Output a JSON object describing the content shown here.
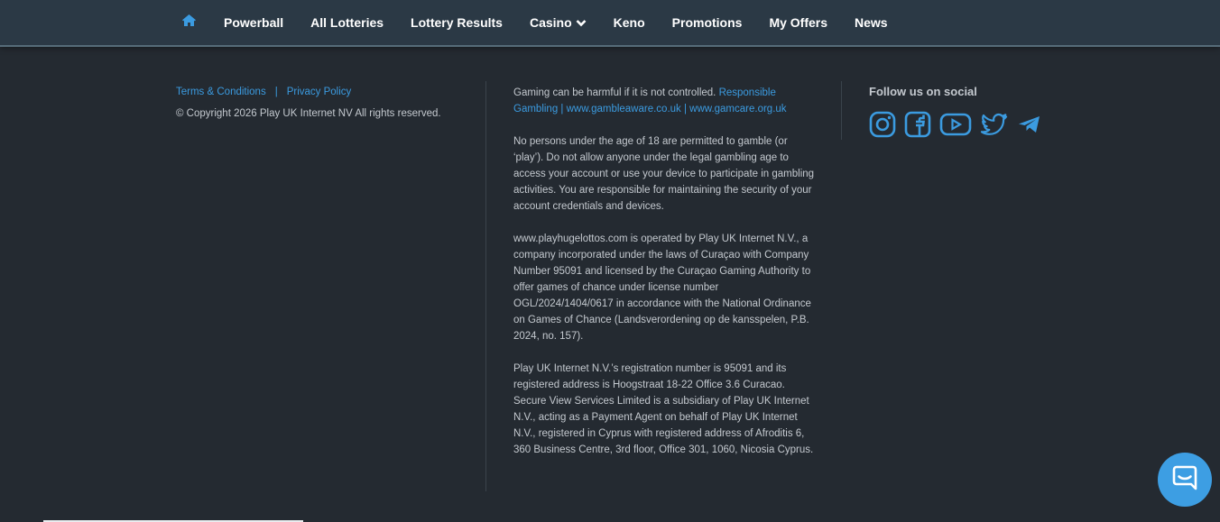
{
  "nav": {
    "home_icon": "home-icon",
    "items": [
      "Powerball",
      "All Lotteries",
      "Lottery Results",
      "Casino",
      "Keno",
      "Promotions",
      "My Offers",
      "News"
    ]
  },
  "footer": {
    "links": {
      "terms": "Terms & Conditions",
      "separator": "|",
      "privacy": "Privacy Policy"
    },
    "copyright": "© Copyright 2026 Play UK Internet NV All rights reserved.",
    "gambling": {
      "text": "Gaming can be harmful if it is not controlled.",
      "link": "Responsible Gambling | www.gambleaware.co.uk | www.gamcare.org.uk"
    },
    "age_notice": "No persons under the age of 18 are permitted to gamble (or ‘play’). Do not allow anyone under the legal gambling age to access your account or use your device to participate in gambling activities. You are responsible for maintaining the security of your account credentials and devices.",
    "operator": "www.playhugelottos.com is operated by Play UK Internet N.V., a company incorporated under the laws of Curaçao with Company Number 95091 and licensed by the Curaçao Gaming Authority to offer games of chance under license number OGL/2024/1404/0617 in accordance with the National Ordinance on Games of Chance (Landsverordening op de kansspelen, P.B. 2024, no. 157).",
    "registration": "Play UK Internet N.V.’s registration number is 95091 and its registered address is Hoogstraat 18-22 Office 3.6 Curacao. Secure View Services Limited is a subsidiary of Play UK Internet N.V., acting as a Payment Agent on behalf of Play UK Internet N.V., registered in Cyprus with registered address of Afroditis 6, 360 Business Centre, 3rd floor, Office 301, 1060, Nicosia Cyprus.",
    "social": {
      "title": "Follow us on social",
      "icons": [
        "instagram-icon",
        "facebook-icon",
        "youtube-icon",
        "twitter-icon",
        "telegram-icon"
      ]
    }
  },
  "colors": {
    "accent": "#3b9be0",
    "nav_bg": "#2b3945",
    "page_bg": "#242a31",
    "chat_bg": "#3d9ee3"
  }
}
